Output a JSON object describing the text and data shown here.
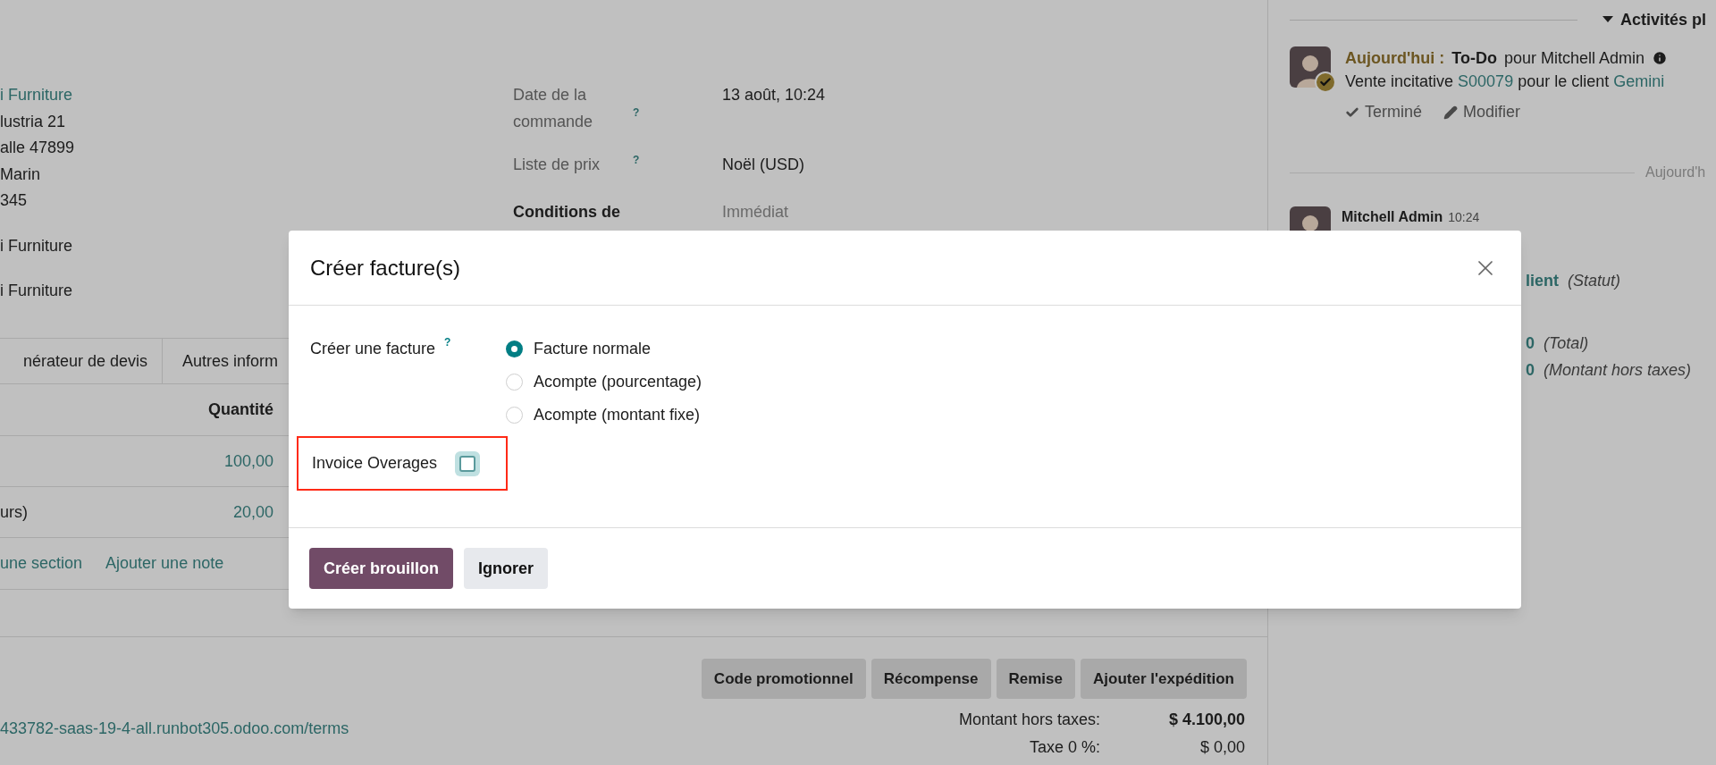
{
  "customer": {
    "groups": [
      {
        "lines": [
          {
            "text": "i Furniture",
            "kind": "link"
          },
          {
            "text": "lustria 21",
            "kind": "plain"
          },
          {
            "text": "alle 47899",
            "kind": "plain"
          },
          {
            "text": "Marin",
            "kind": "plain"
          },
          {
            "text": "345",
            "kind": "plain"
          }
        ]
      },
      {
        "lines": [
          {
            "text": "i Furniture",
            "kind": "plain"
          }
        ]
      },
      {
        "lines": [
          {
            "text": "i Furniture",
            "kind": "plain"
          }
        ]
      }
    ]
  },
  "fields": [
    {
      "label": "Date de la commande",
      "help": "?",
      "value": "13 août, 10:24",
      "kind": "plain"
    },
    {
      "label": "Liste de prix",
      "help": "?",
      "value": "Noël (USD)",
      "kind": "plain"
    },
    {
      "label": "Conditions de",
      "value": "Immédiat",
      "kind": "required"
    }
  ],
  "tabs": [
    {
      "label": "nérateur de devis"
    },
    {
      "label": "Autres inform"
    }
  ],
  "table": {
    "columns": [
      "Quantité"
    ],
    "rows": [
      {
        "column_1": "",
        "quantity": "100,00"
      },
      {
        "column_1": "urs)",
        "quantity": "20,00"
      }
    ]
  },
  "add_links": [
    "une section",
    "Ajouter une note"
  ],
  "actions": [
    "Code promotionnel",
    "Récompense",
    "Remise",
    "Ajouter l'expédition"
  ],
  "terms_link": "433782-saas-19-4-all.runbot305.odoo.com/terms",
  "totals": [
    {
      "label": "Montant hors taxes:",
      "value": "$ 4.100,00",
      "bold": true
    },
    {
      "label": "Taxe 0 %:",
      "value": "$ 0,00",
      "bold": false
    }
  ],
  "chatter": {
    "activities_toggle": "Activités pl",
    "activity": {
      "when": "Aujourd'hui :",
      "type": "To-Do",
      "assignee": "pour Mitchell Admin",
      "summary": [
        {
          "text": "Vente incitative",
          "kind": "plain"
        },
        {
          "text": "S00079",
          "kind": "link"
        },
        {
          "text": "pour le client",
          "kind": "plain"
        },
        {
          "text": "Gemini",
          "kind": "link"
        }
      ],
      "buttons": [
        {
          "label": "Terminé",
          "kind": "done"
        },
        {
          "label": "Modifier",
          "kind": "edit"
        }
      ]
    },
    "date_separator": "Aujourd'h",
    "message": {
      "author": "Mitchell Admin",
      "time": "10:24",
      "tracking": [
        {
          "value": "lient",
          "field": "(Statut)"
        },
        {
          "value": "0",
          "field": "(Total)"
        },
        {
          "value": "0",
          "field": "(Montant hors taxes)"
        }
      ]
    }
  },
  "dialog": {
    "title": "Créer facture(s)",
    "field": {
      "label": "Créer une facture",
      "help": "?",
      "options": [
        {
          "label": "Facture normale",
          "selected": true
        },
        {
          "label": "Acompte (pourcentage)",
          "selected": false
        },
        {
          "label": "Acompte (montant fixe)",
          "selected": false
        }
      ]
    },
    "checkbox": {
      "label": "Invoice Overages",
      "checked": false,
      "highlighted": true
    },
    "buttons": [
      {
        "label": "Créer brouillon",
        "kind": "primary"
      },
      {
        "label": "Ignorer",
        "kind": "secondary"
      }
    ]
  }
}
